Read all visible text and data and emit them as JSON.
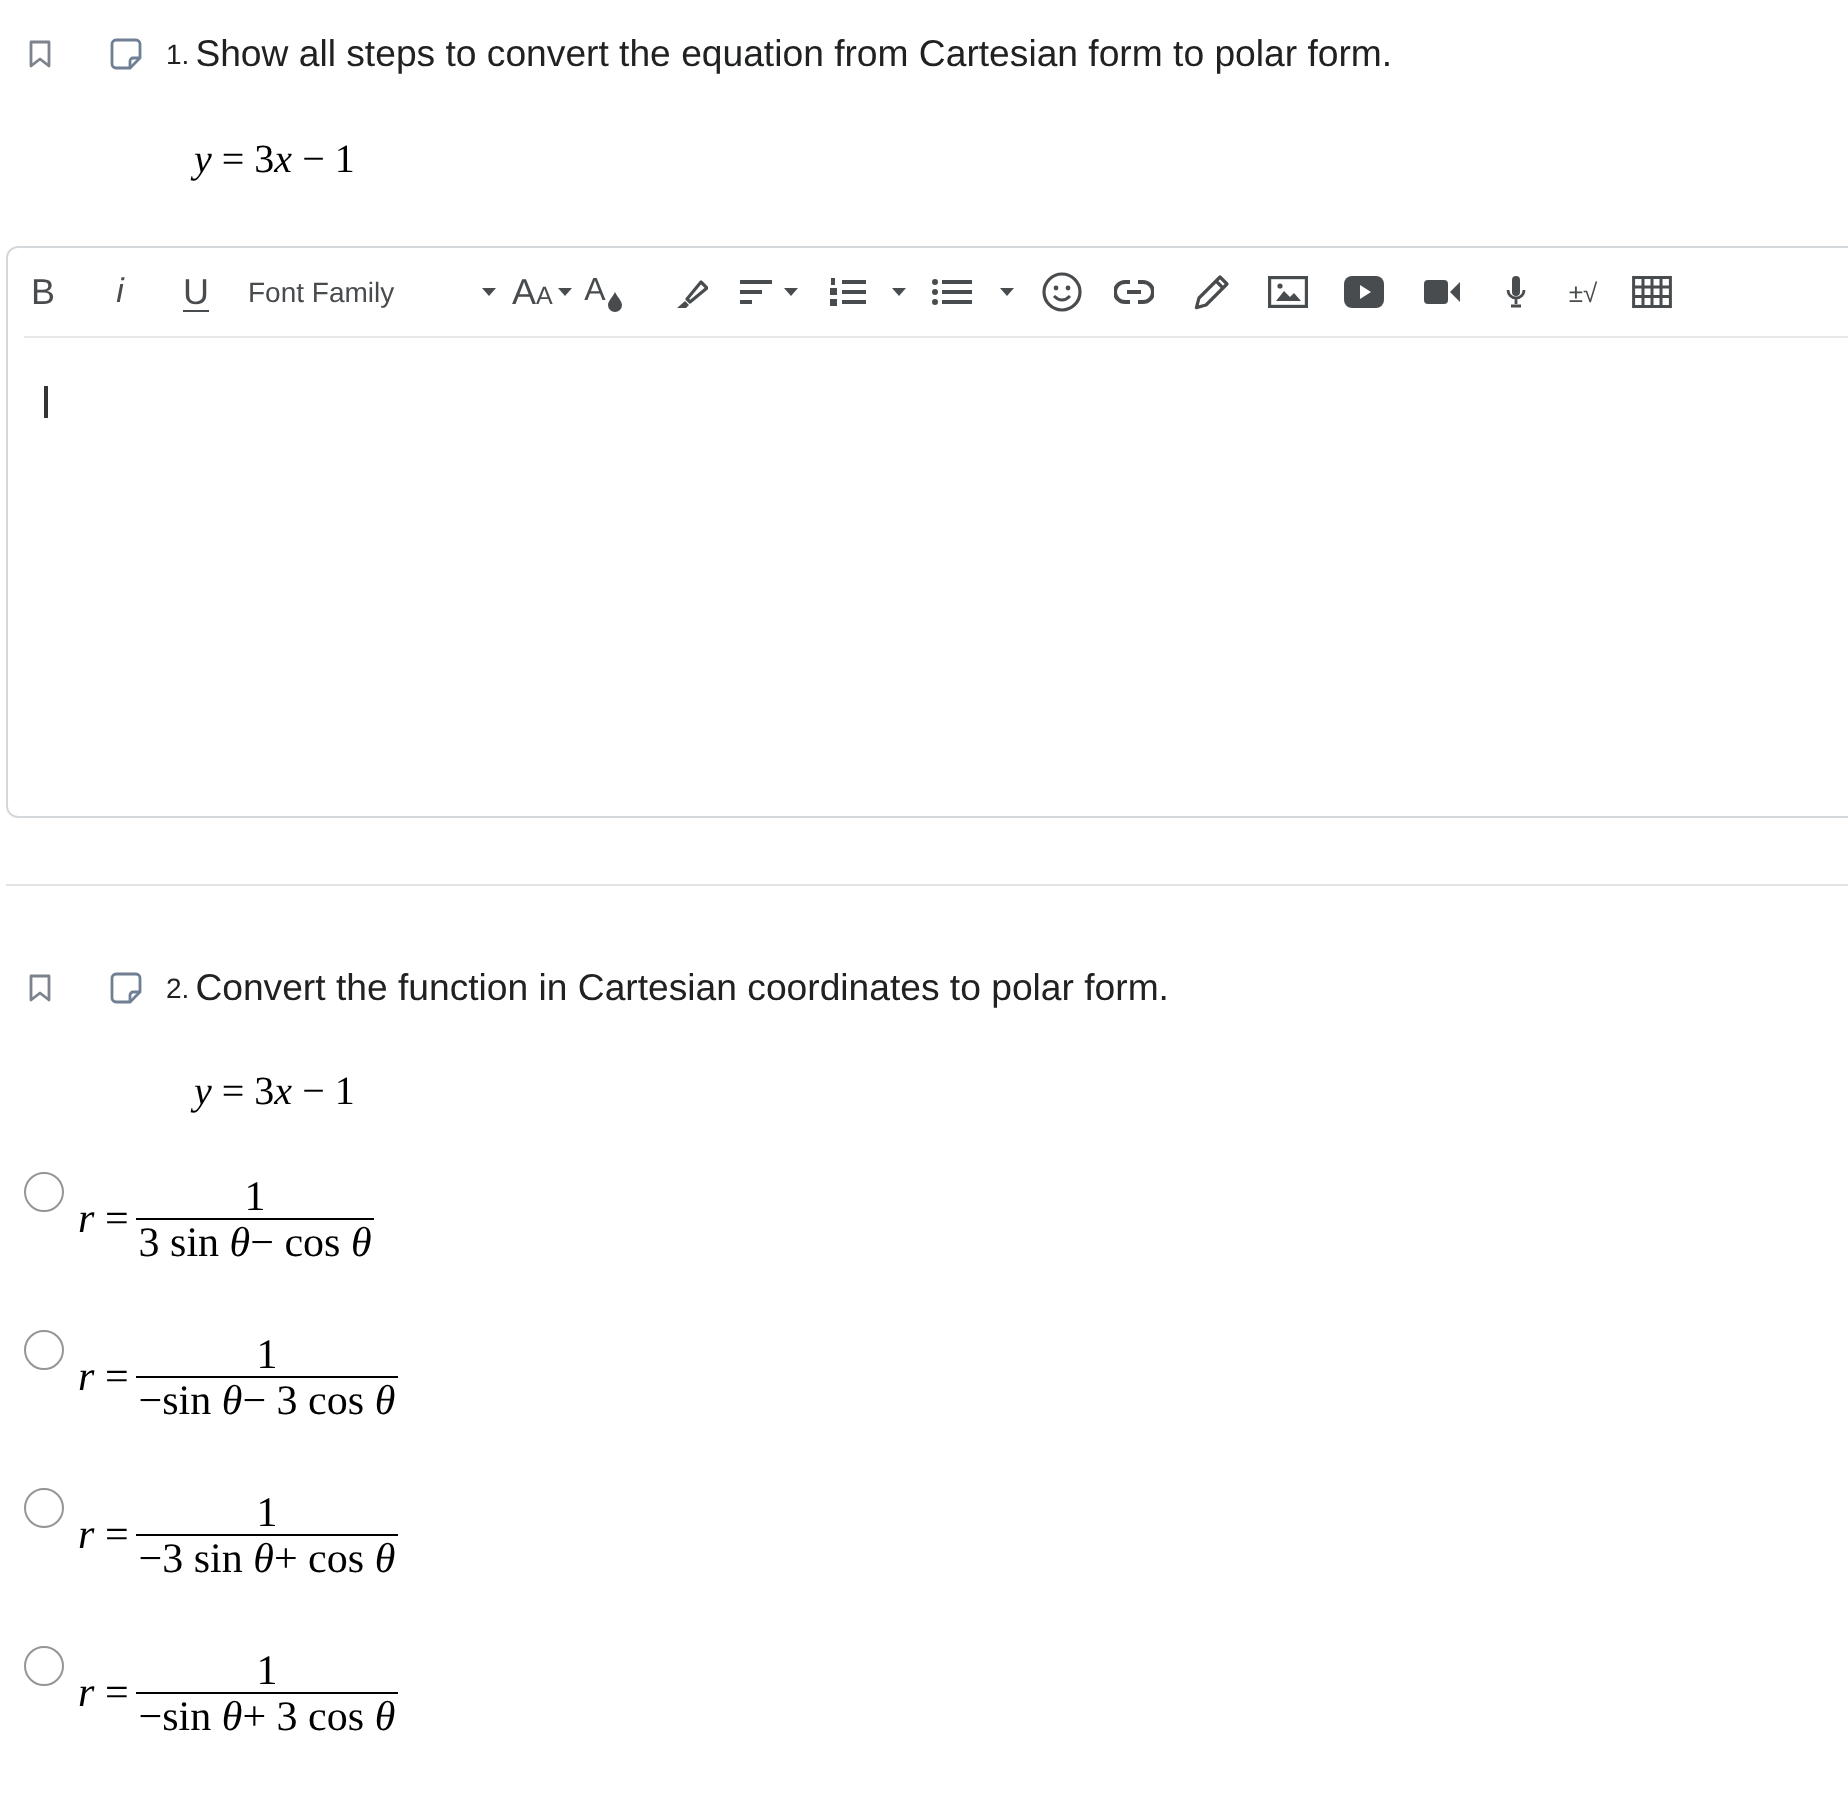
{
  "questions": [
    {
      "number": "1.",
      "text": "Show all steps to convert the equation from Cartesian form to polar form.",
      "equation": [
        "*y* = 3",
        "*x* − 1"
      ],
      "editor": {
        "focused": true,
        "toolbar": [
          {
            "kind": "bold",
            "label": "B",
            "dropdown": false
          },
          {
            "kind": "italic",
            "label": "i",
            "dropdown": false
          },
          {
            "kind": "underline",
            "label": "U",
            "dropdown": false
          },
          {
            "kind": "font-family",
            "label": "Font Family",
            "dropdown": true
          },
          {
            "kind": "font-size",
            "label": "AA",
            "dropdown": true
          },
          {
            "kind": "text-color",
            "label": "A",
            "dropdown": false
          },
          {
            "kind": "highlight",
            "dropdown": false
          },
          {
            "kind": "align",
            "dropdown": true
          },
          {
            "kind": "numbered-list",
            "dropdown": true
          },
          {
            "kind": "bullet-list",
            "dropdown": true
          },
          {
            "kind": "emoji",
            "dropdown": false
          },
          {
            "kind": "link",
            "dropdown": false
          },
          {
            "kind": "draw",
            "dropdown": false
          },
          {
            "kind": "image",
            "dropdown": false
          },
          {
            "kind": "video-embed",
            "dropdown": false
          },
          {
            "kind": "video-record",
            "dropdown": false
          },
          {
            "kind": "audio-record",
            "dropdown": false
          },
          {
            "kind": "equation",
            "label": "±√",
            "dropdown": false
          },
          {
            "kind": "table",
            "dropdown": false
          }
        ]
      }
    },
    {
      "number": "2.",
      "text": "Convert the function in Cartesian coordinates to polar form.",
      "equation": [
        "*y* = 3",
        "*x* − 1"
      ],
      "options": [
        {
          "lhs": "*r* =",
          "numerator": "1",
          "denominator": "3 sin *θ*− cos *θ*",
          "selected": false
        },
        {
          "lhs": "*r* =",
          "numerator": "1",
          "denominator": "−sin *θ*− 3 cos *θ*",
          "selected": false
        },
        {
          "lhs": "*r* =",
          "numerator": "1",
          "denominator": "−3 sin *θ*+ cos *θ*",
          "selected": false
        },
        {
          "lhs": "*r* =",
          "numerator": "1",
          "denominator": "−sin *θ*+ 3 cos *θ*",
          "selected": false
        }
      ]
    }
  ]
}
